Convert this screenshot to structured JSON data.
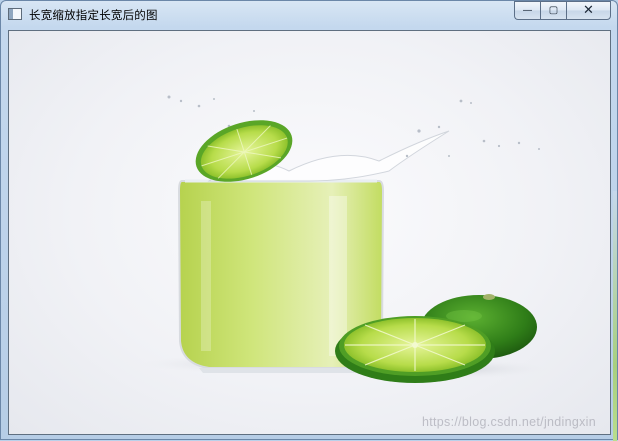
{
  "window": {
    "title": "长宽缩放指定长宽后的图",
    "controls": {
      "minimize_icon": "minimize-icon",
      "maximize_icon": "maximize-icon",
      "close_icon": "close-icon",
      "minimize_glyph": "—",
      "maximize_glyph": "▢",
      "close_glyph": "✕"
    }
  },
  "image": {
    "subject": "glass of lime juice with splashing lime slice and limes",
    "watermark": "https://blog.csdn.net/jndingxin"
  },
  "colors": {
    "titlebar": "#c4d8ee",
    "juice": "#c6e06a",
    "lime_dark": "#3f8f1f",
    "background": "#f1f2f6"
  }
}
